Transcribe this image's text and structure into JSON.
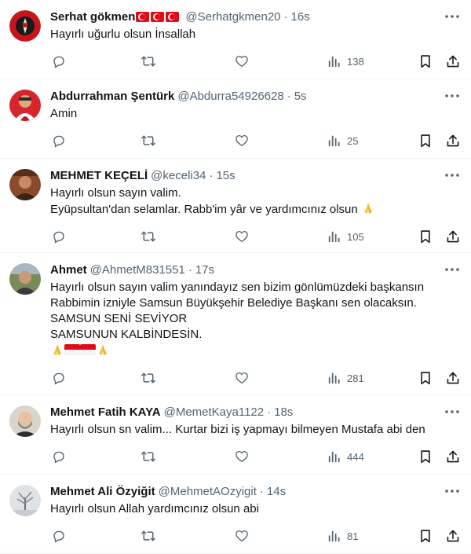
{
  "colors": {
    "accent": "#1d9bf0",
    "secondary_text": "#536471",
    "border": "#eff3f4"
  },
  "icons": [
    "reply-icon",
    "retweet-icon",
    "like-icon",
    "views-icon",
    "bookmark-icon",
    "share-icon",
    "more-icon"
  ],
  "tweets": [
    {
      "name": "Serhat gökmen",
      "flags": 3,
      "handle": "@Serhatgkmen20",
      "time": "16s",
      "lines": [
        "Hayırlı uğurlu olsun İnsallah"
      ],
      "views": "138"
    },
    {
      "name": "Abdurrahman Şentürk",
      "handle": "@Abdurra54926628",
      "time": "5s",
      "lines": [
        "Amin"
      ],
      "views": "25"
    },
    {
      "name": "MEHMET KEÇELİ",
      "handle": "@keceli34",
      "time": "15s",
      "lines": [
        "Hayırlı olsun sayın valim.",
        "Eyüpsultan'dan selamlar. Rabb'im yâr ve yardımcınız olsun"
      ],
      "views": "105"
    },
    {
      "name": "Ahmet",
      "handle": "@AhmetM831551",
      "time": "17s",
      "lines": [
        "Hayırlı olsun sayın valim yanındayız sen bizim gönlümüzdeki başkansın",
        "Rabbimin izniyle Samsun Büyükşehir Belediye Başkanı sen olacaksın.",
        "SAMSUN SENİ SEVİYOR",
        "SAMSUNUN KALBİNDESİN."
      ],
      "views": "281"
    },
    {
      "name": "Mehmet Fatih KAYA",
      "handle": "@MemetKaya1122",
      "time": "18s",
      "lines": [
        "Hayırlı olsun sn valim... Kurtar bizi iş yapmayı bilmeyen Mustafa abi den"
      ],
      "views": "444"
    },
    {
      "name": "Mehmet Ali Özyiğit",
      "handle": "@MehmetAOzyigit",
      "time": "14s",
      "lines": [
        "Hayırlı olsun Allah yardımcınız olsun abi"
      ],
      "views": "81"
    }
  ]
}
